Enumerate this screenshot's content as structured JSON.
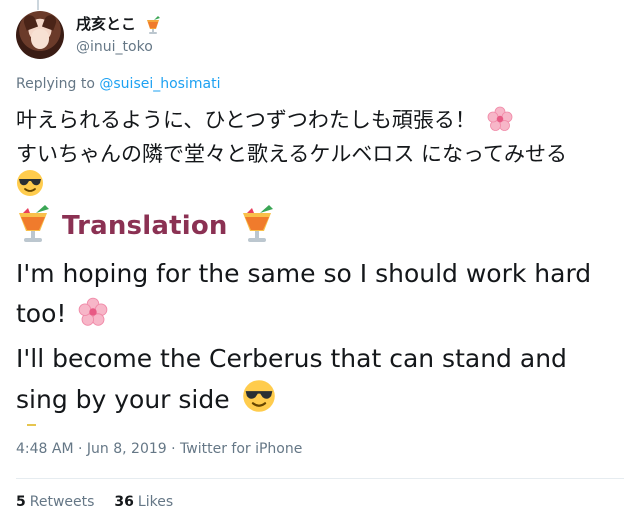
{
  "user": {
    "display_name": "戌亥とこ",
    "handle": "@inui_toko"
  },
  "reply": {
    "prefix": "Replying to ",
    "mention": "@suisei_hosimati"
  },
  "tweet": {
    "jp_line1": "叶えられるように、ひとつずつわたしも頑張る！",
    "jp_line2": "すいちゃんの隣で堂々と歌えるケルベロス になってみせる",
    "translation_title": "Translation",
    "en_line1": "I'm hoping for the same so I should work hard too!",
    "en_line2": "I'll become the Cerberus that can stand and sing by your side"
  },
  "meta": {
    "time": "4:48 AM",
    "date": "Jun 8, 2019",
    "source": "Twitter for iPhone"
  },
  "stats": {
    "retweets_count": "5",
    "retweets_label": "Retweets",
    "likes_count": "36",
    "likes_label": "Likes"
  },
  "icons": [
    "tropical-drink-icon",
    "cherry-blossom-icon",
    "sunglasses-face-icon"
  ],
  "colors": {
    "accent": "#1da1f2",
    "translation": "#8b3153",
    "muted": "#657786"
  }
}
